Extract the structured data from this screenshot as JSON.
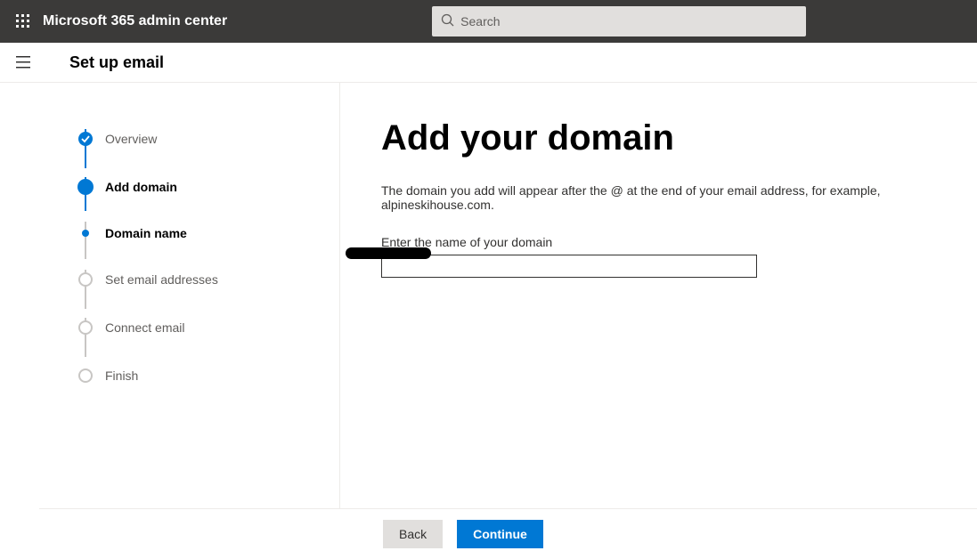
{
  "header": {
    "app_title": "Microsoft 365 admin center",
    "search_placeholder": "Search"
  },
  "subheader": {
    "page_title": "Set up email"
  },
  "steps": {
    "overview": "Overview",
    "add_domain": "Add domain",
    "domain_name": "Domain name",
    "set_email": "Set email addresses",
    "connect_email": "Connect email",
    "finish": "Finish"
  },
  "main": {
    "heading": "Add your domain",
    "description": "The domain you add will appear after the @ at the end of your email address, for example, alpineskihouse.com.",
    "field_label": "Enter the name of your domain",
    "field_value": ""
  },
  "footer": {
    "back": "Back",
    "continue": "Continue"
  }
}
